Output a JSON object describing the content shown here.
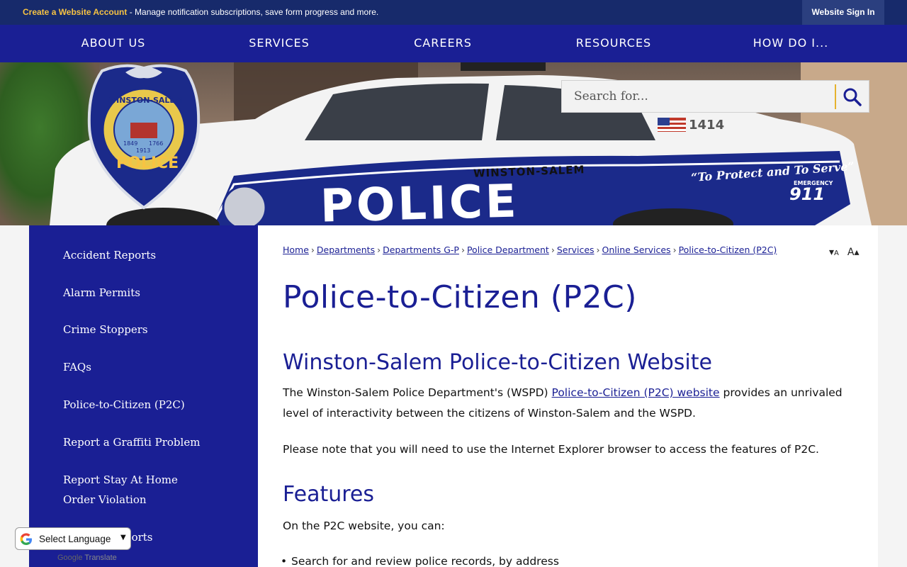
{
  "topbar": {
    "create_account": "Create a Website Account",
    "create_account_desc": " - Manage notification subscriptions, save form progress and more.",
    "sign_in": "Website Sign In"
  },
  "nav": [
    "ABOUT US",
    "SERVICES",
    "CAREERS",
    "RESOURCES",
    "HOW DO I..."
  ],
  "search": {
    "placeholder": "Search for..."
  },
  "badge": {
    "line1": "WINSTON-SALEM",
    "year_left": "1849",
    "year_right": "1766",
    "year_center": "1913",
    "word": "POLICE"
  },
  "car": {
    "number": "1414",
    "city": "WINSTON-SALEM",
    "word": "POLICE",
    "motto": "“To Protect and To Serve”",
    "emergency": "EMERGENCY",
    "emergency_number": "911"
  },
  "sidebar": [
    "Accident Reports",
    "Alarm Permits",
    "Crime Stoppers",
    "FAQs",
    "Police-to-Citizen (P2C)",
    "Report a Graffiti Problem",
    "Report Stay At Home Order Violation",
    "Request Reports"
  ],
  "breadcrumb": [
    "Home",
    "Departments",
    "Departments G-P",
    "Police Department",
    "Services",
    "Online Services",
    "Police-to-Citizen (P2C)"
  ],
  "font_controls": {
    "decrease": "A",
    "increase": "A"
  },
  "page_title": "Police-to-Citizen (P2C)",
  "section1": {
    "heading": "Winston-Salem Police-to-Citizen Website",
    "p1_before": "The Winston-Salem Police Department's (WSPD) ",
    "p1_link": "Police-to-Citizen (P2C) website",
    "p1_after": " provides an unrivaled level of interactivity between the citizens of Winston-Salem and the WSPD.",
    "p2": "Please note that you will need to use the Internet Explorer browser to access the features of P2C."
  },
  "section2": {
    "heading": "Features",
    "intro": "On the P2C website, you can:",
    "bullets": [
      "Search for and review police records, by address"
    ]
  },
  "translate": {
    "select_label": "Select Language",
    "powered_google": "Google",
    "powered_translate": "Translate"
  },
  "colors": {
    "navy": "#1a1f94",
    "topbar": "#172a6b",
    "accent": "#f6c343"
  }
}
